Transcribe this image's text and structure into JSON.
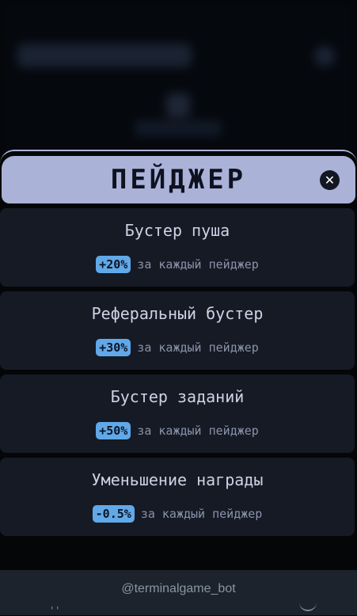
{
  "modal": {
    "title": "ПЕЙДЖЕР",
    "close_icon": "close-icon"
  },
  "boosters": [
    {
      "title": "Бустер пуша",
      "value": "+20%",
      "suffix": "за каждый пейджер"
    },
    {
      "title": "Реферальный бустер",
      "value": "+30%",
      "suffix": "за каждый пейджер"
    },
    {
      "title": "Бустер заданий",
      "value": "+50%",
      "suffix": "за каждый пейджер"
    },
    {
      "title": "Уменьшение награды",
      "value": "-0.5%",
      "suffix": "за каждый пейджер"
    }
  ],
  "footer": {
    "bot_handle": "@terminalgame_bot"
  },
  "colors": {
    "header_bg": "#aab2d8",
    "card_bg": "#161a24",
    "badge_bg": "#61a8e8",
    "footer_bg": "#1c232c"
  }
}
